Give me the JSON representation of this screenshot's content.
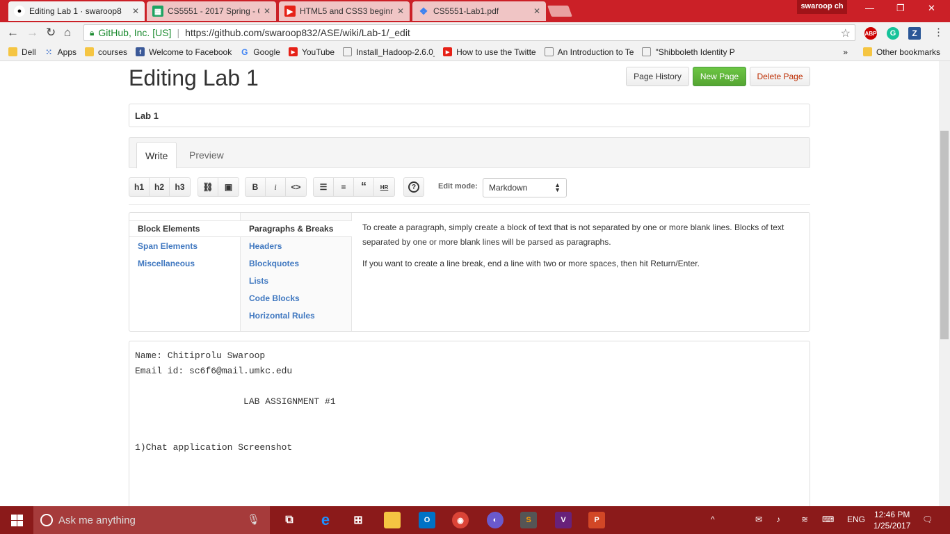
{
  "browser": {
    "tabs": [
      {
        "title": "Editing Lab 1 · swaroop8",
        "active": true
      },
      {
        "title": "CS5551 - 2017 Spring - C",
        "active": false
      },
      {
        "title": "HTML5 and CSS3 beginn",
        "active": false
      },
      {
        "title": "CS5551-Lab1.pdf",
        "active": false
      }
    ],
    "user": "swaroop ch",
    "address": {
      "org": "GitHub, Inc. [US]",
      "url": "https://github.com/swaroop832/ASE/wiki/Lab-1/_edit"
    },
    "extensions": [
      "ABP",
      "G",
      "Z"
    ],
    "bookmarks": [
      "Dell",
      "Apps",
      "courses",
      "Welcome to Facebook",
      "Google",
      "YouTube",
      "Install_Hadoop-2.6.0_",
      "How to use the Twitte",
      "An Introduction to Te",
      "\"Shibboleth Identity P"
    ],
    "other_bookmarks": "Other bookmarks",
    "overflow": "»"
  },
  "page": {
    "title": "Editing Lab 1",
    "buttons": {
      "history": "Page History",
      "new": "New Page",
      "delete": "Delete Page"
    },
    "page_name": "Lab 1",
    "editor_tabs": {
      "write": "Write",
      "preview": "Preview"
    },
    "toolbar": {
      "h1": "h1",
      "h2": "h2",
      "h3": "h3",
      "bold": "B",
      "italic": "i",
      "code": "<>",
      "quote": "“",
      "hr": "HR",
      "help": "?"
    },
    "edit_mode_label": "Edit mode:",
    "edit_mode_value": "Markdown",
    "help": {
      "categories": [
        "Block Elements",
        "Span Elements",
        "Miscellaneous"
      ],
      "topics": [
        "Paragraphs & Breaks",
        "Headers",
        "Blockquotes",
        "Lists",
        "Code Blocks",
        "Horizontal Rules"
      ],
      "text1": "To create a paragraph, simply create a block of text that is not separated by one or more blank lines. Blocks of text separated by one or more blank lines will be parsed as paragraphs.",
      "text2": "If you want to create a line break, end a line with two or more spaces, then hit Return/Enter."
    },
    "content": "Name: Chitiprolu Swaroop\nEmail id: sc6f6@mail.umkc.edu\n\n                    LAB ASSIGNMENT #1\n\n\n1)Chat application Screenshot"
  },
  "taskbar": {
    "search_placeholder": "Ask me anything",
    "language": "ENG",
    "time": "12:46 PM",
    "date": "1/25/2017"
  }
}
